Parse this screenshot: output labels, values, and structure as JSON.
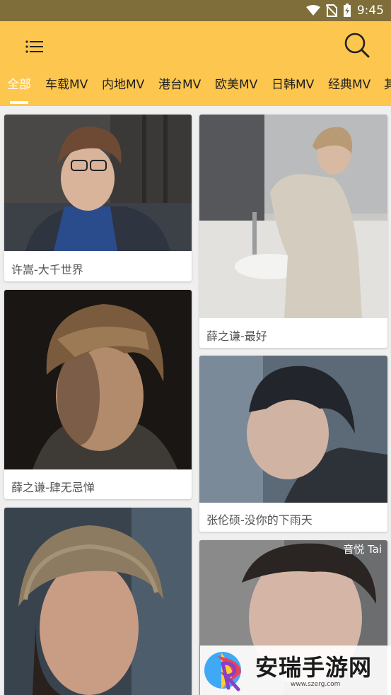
{
  "status_bar": {
    "time": "9:45"
  },
  "header": {
    "menu_icon": "hamburger-menu-icon",
    "search_icon": "search-icon",
    "accent_color": "#fdc64f"
  },
  "tabs": [
    {
      "label": "全部",
      "active": true
    },
    {
      "label": "车载MV"
    },
    {
      "label": "内地MV"
    },
    {
      "label": "港台MV"
    },
    {
      "label": "欧美MV"
    },
    {
      "label": "日韩MV"
    },
    {
      "label": "经典MV"
    },
    {
      "label": "其"
    }
  ],
  "cards": [
    {
      "title": "许嵩-大千世界"
    },
    {
      "title": "薛之谦-最好"
    },
    {
      "title": "薛之谦-肆无忌惮"
    },
    {
      "title": "张伦硕-没你的下雨天"
    },
    {
      "title": ""
    },
    {
      "title": "",
      "overlay_text": "音悦 Tai"
    }
  ],
  "watermark": {
    "text": "安瑞手游网",
    "url": "www.szerg.com"
  }
}
